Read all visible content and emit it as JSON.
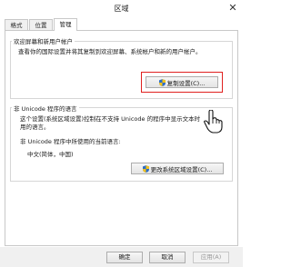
{
  "window": {
    "title": "区域",
    "close_glyph": "✕"
  },
  "tabs": [
    {
      "label": "格式"
    },
    {
      "label": "位置"
    },
    {
      "label": "管理"
    }
  ],
  "welcome_group": {
    "title": "欢迎屏幕和新用户帐户",
    "description": "查看你的国际设置并将其复制到欢迎屏幕、系统帐户和新的用户帐户。",
    "copy_button_label": "复制设置(C)..."
  },
  "unicode_group": {
    "title": "非 Unicode 程序的语言",
    "description_line1": "这个设置(系统区域设置)控制在不支持 Unicode 的程序中显示文本时",
    "description_line2": "用的语言。",
    "current_label": "非 Unicode 程序中所使用的当前语言:",
    "current_value": "中文(简体，中国)",
    "change_button_label": "更改系统区域设置(C)..."
  },
  "footer": {
    "ok_label": "确定",
    "cancel_label": "取消",
    "apply_label": "应用(A)"
  },
  "colors": {
    "highlight": "#e0201f",
    "shield_blue": "#2d6ec8",
    "shield_yellow": "#f2c21b"
  }
}
